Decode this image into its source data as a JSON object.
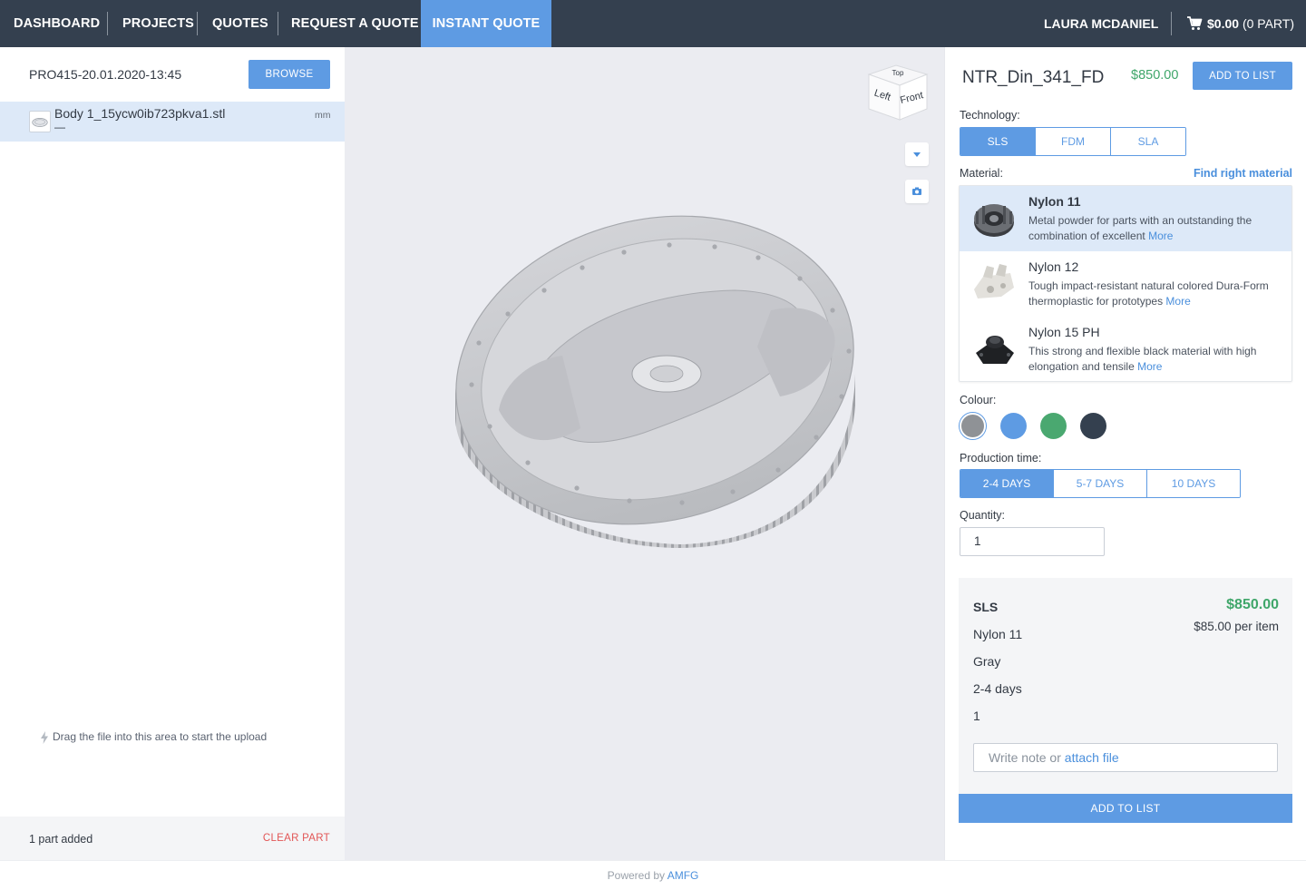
{
  "nav": {
    "items": [
      "DASHBOARD",
      "PROJECTS",
      "QUOTES",
      "REQUEST A QUOTE",
      "INSTANT QUOTE"
    ],
    "user": "LAURA MCDANIEL",
    "cart_amount": "$0.00",
    "cart_parts": "(0 PART)"
  },
  "left": {
    "project": "PRO415-20.01.2020-13:45",
    "browse": "BROWSE",
    "file": {
      "name": "Body 1_15ycw0ib723pkva1.stl",
      "sub": "—",
      "unit": "mm"
    },
    "drag_hint": "Drag the file into this area to start the upload",
    "parts_added": "1 part added",
    "clear": "CLEAR PART"
  },
  "viewer": {
    "cube": {
      "top": "Top",
      "left": "Left",
      "front": "Front"
    }
  },
  "right": {
    "part_name": "NTR_Din_341_FD",
    "price": "$850.00",
    "add_top": "ADD TO LIST",
    "technology_label": "Technology:",
    "technologies": [
      "SLS",
      "FDM",
      "SLA"
    ],
    "material_label": "Material:",
    "find_material": "Find right material",
    "materials": [
      {
        "name": "Nylon 11",
        "desc": "Metal powder for parts with an outstanding the combination of excellent",
        "more": "More"
      },
      {
        "name": "Nylon 12",
        "desc": "Tough impact-resistant natural colored Dura-Form thermoplastic for prototypes",
        "more": "More"
      },
      {
        "name": "Nylon 15 PH",
        "desc": "This strong and flexible black material with high elongation and tensile",
        "more": "More"
      }
    ],
    "colour_label": "Colour:",
    "colours": [
      "#8f9296",
      "#5e9be3",
      "#4aa870",
      "#34404f"
    ],
    "production_label": "Production time:",
    "production": [
      "2-4 DAYS",
      "5-7 DAYS",
      "10 DAYS"
    ],
    "quantity_label": "Quantity:",
    "quantity": "1",
    "summary": {
      "tech": "SLS",
      "material": "Nylon 11",
      "colour": "Gray",
      "time": "2-4 days",
      "qty": "1",
      "total": "$850.00",
      "per_item": "$85.00 per item",
      "note_placeholder": "Write note or",
      "attach": "attach file",
      "add": "ADD TO LIST"
    }
  },
  "footer": {
    "powered": "Powered by",
    "brand": "AMFG"
  }
}
